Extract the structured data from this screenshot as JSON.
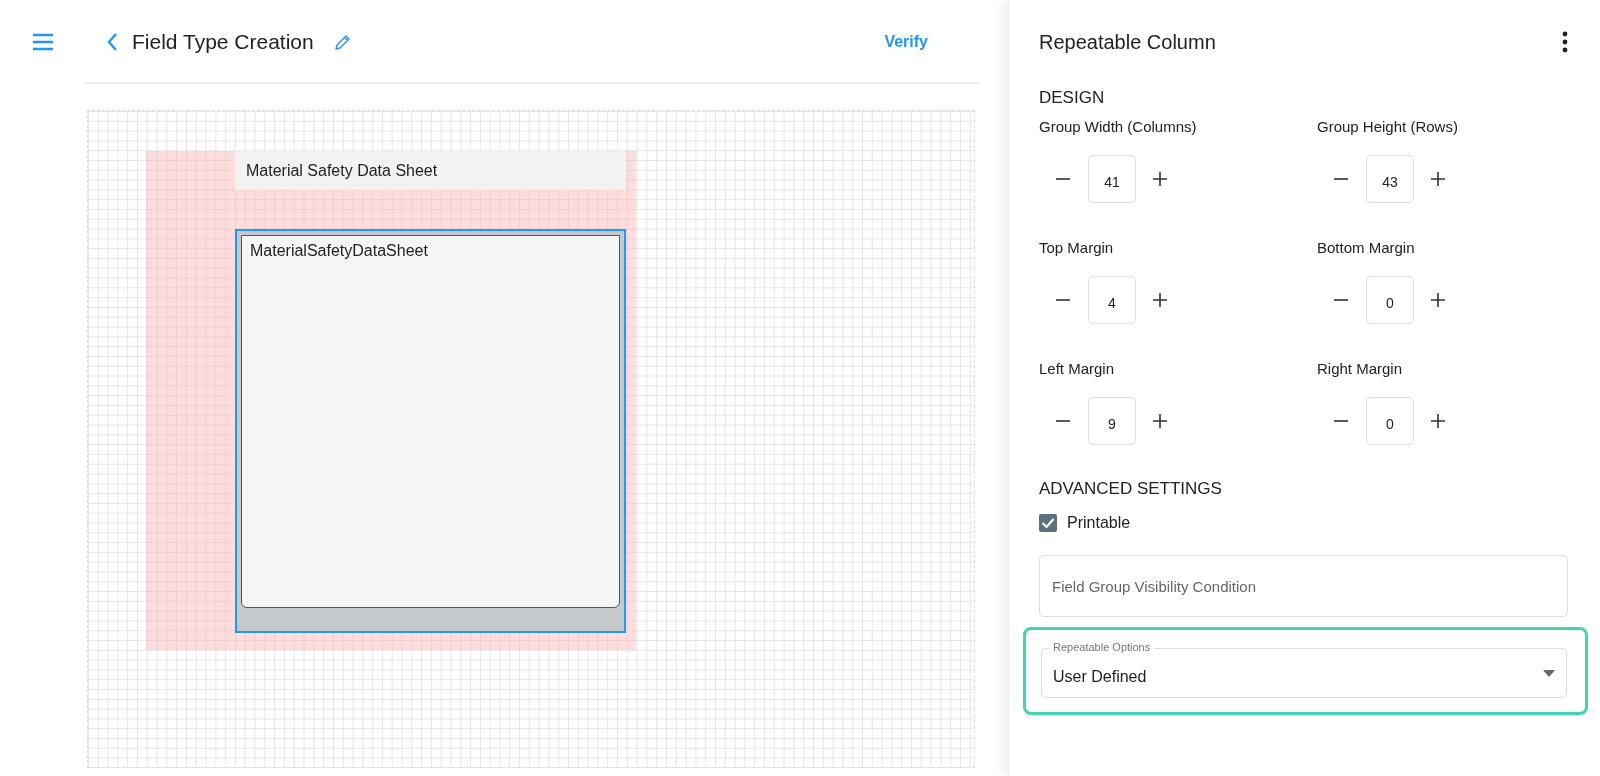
{
  "header": {
    "title": "Field Type Creation",
    "action": "Verify"
  },
  "canvas": {
    "group_title": "Material Safety Data Sheet",
    "field_name": "MaterialSafetyDataSheet",
    "field_selected": true
  },
  "panel": {
    "title": "Repeatable Column",
    "design_heading": "DESIGN",
    "steppers": [
      {
        "label": "Group Width (Columns)",
        "value": "41"
      },
      {
        "label": "Group Height (Rows)",
        "value": "43"
      },
      {
        "label": "Top Margin",
        "value": "4"
      },
      {
        "label": "Bottom Margin",
        "value": "0"
      },
      {
        "label": "Left Margin",
        "value": "9"
      },
      {
        "label": "Right Margin",
        "value": "0"
      }
    ],
    "advanced_heading": "ADVANCED SETTINGS",
    "printable": {
      "label": "Printable",
      "checked": true
    },
    "visibility": {
      "placeholder": "Field Group Visibility Condition"
    },
    "repeatable": {
      "label": "Repeatable Options",
      "value": "User Defined",
      "highlighted": true
    }
  }
}
